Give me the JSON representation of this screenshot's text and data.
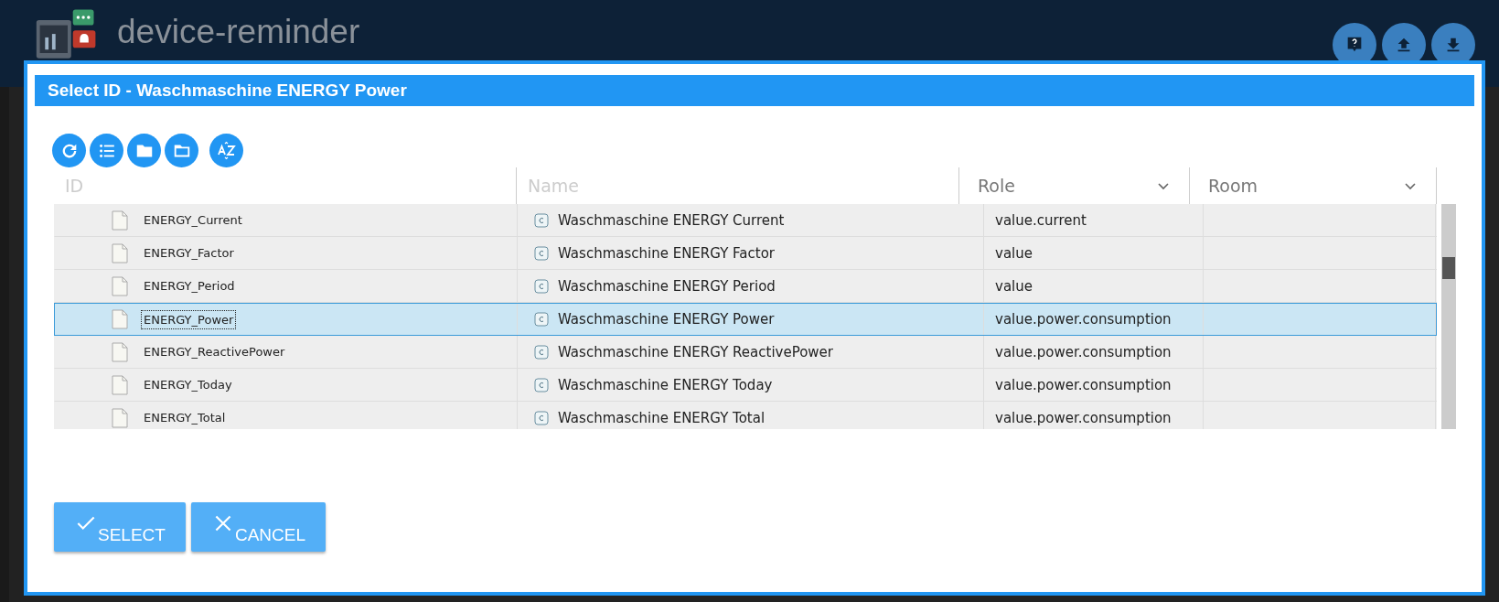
{
  "app": {
    "title": "device-reminder"
  },
  "dialog": {
    "title": "Select ID - Waschmaschine ENERGY Power",
    "columns": [
      {
        "kind": "text",
        "placeholder": "ID"
      },
      {
        "kind": "text",
        "placeholder": "Name"
      },
      {
        "kind": "select",
        "label": "Role"
      },
      {
        "kind": "select",
        "label": "Room"
      }
    ],
    "rows": [
      {
        "id": "ENERGY_Current",
        "name": "Waschmaschine ENERGY Current",
        "role": "value.current",
        "selected": false
      },
      {
        "id": "ENERGY_Factor",
        "name": "Waschmaschine ENERGY Factor",
        "role": "value",
        "selected": false
      },
      {
        "id": "ENERGY_Period",
        "name": "Waschmaschine ENERGY Period",
        "role": "value",
        "selected": false
      },
      {
        "id": "ENERGY_Power",
        "name": "Waschmaschine ENERGY Power",
        "role": "value.power.consumption",
        "selected": true
      },
      {
        "id": "ENERGY_ReactivePower",
        "name": "Waschmaschine ENERGY ReactivePower",
        "role": "value.power.consumption",
        "selected": false
      },
      {
        "id": "ENERGY_Today",
        "name": "Waschmaschine ENERGY Today",
        "role": "value.power.consumption",
        "selected": false
      },
      {
        "id": "ENERGY_Total",
        "name": "Waschmaschine ENERGY Total",
        "role": "value.power.consumption",
        "selected": false
      }
    ],
    "buttons": [
      {
        "kind": "select",
        "label": "SELECT"
      },
      {
        "kind": "cancel",
        "label": "CANCEL"
      }
    ]
  }
}
